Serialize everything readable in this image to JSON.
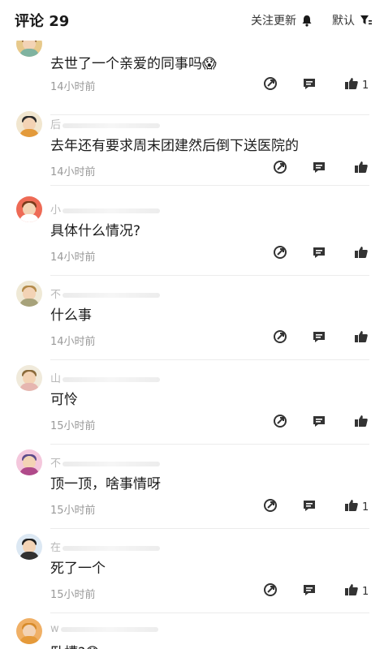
{
  "header": {
    "title": "评论 29",
    "follow_label": "关注更新",
    "sort_label": "默认"
  },
  "comments": [
    {
      "name": "",
      "text": "去世了一个亲爱的同事吗😱",
      "time": "14小时前",
      "likes": "1",
      "avatar_color": "#e7c98b",
      "hair": "#8a5a2b",
      "body": "#7fb3a0"
    },
    {
      "name": "后",
      "text": "去年还有要求周末团建然后倒下送医院的",
      "time": "14小时前",
      "likes": "",
      "avatar_color": "#f1e6cf",
      "hair": "#2b2b2b",
      "body": "#e39a3b"
    },
    {
      "name": "小",
      "text": "具体什么情况?",
      "time": "14小时前",
      "likes": "",
      "avatar_color": "#ee6a55",
      "hair": "#7a3a1a",
      "body": "#ffffff"
    },
    {
      "name": "不",
      "text": "什么事",
      "time": "14小时前",
      "likes": "",
      "avatar_color": "#efe9d6",
      "hair": "#b48b4a",
      "body": "#a7a27a"
    },
    {
      "name": "山",
      "text": "可怜",
      "time": "15小时前",
      "likes": "",
      "avatar_color": "#f0eadb",
      "hair": "#8a6a3a",
      "body": "#e6b6b0"
    },
    {
      "name": "不",
      "text": "顶一顶，啥事情呀",
      "time": "15小时前",
      "likes": "1",
      "avatar_color": "#f4c7dc",
      "hair": "#5c4a8a",
      "body": "#b04a8a"
    },
    {
      "name": "在",
      "text": "死了一个",
      "time": "15小时前",
      "likes": "1",
      "avatar_color": "#dce8f3",
      "hair": "#1f1f1f",
      "body": "#303030"
    },
    {
      "name": "w",
      "text": "卧槽?😱",
      "time": "",
      "likes": "",
      "avatar_color": "#f0b066",
      "hair": "#d78a2a",
      "body": "#e59a3a"
    }
  ]
}
